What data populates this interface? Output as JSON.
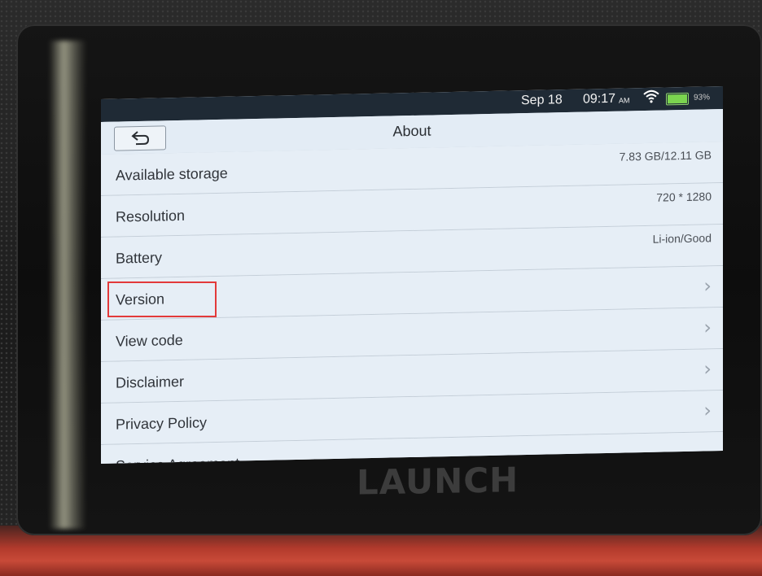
{
  "status_bar": {
    "date": "Sep 18",
    "time": "09:17",
    "ampm": "AM",
    "battery_percent": "93%",
    "wifi_icon": "wifi-icon",
    "battery_icon": "battery-icon"
  },
  "header": {
    "title": "About",
    "back_icon": "back-arrow-icon"
  },
  "rows": [
    {
      "label": "Available storage",
      "value": "7.83 GB/12.11 GB"
    },
    {
      "label": "Resolution",
      "value": "720 * 1280"
    },
    {
      "label": "Battery",
      "value": "Li-ion/Good"
    },
    {
      "label": "Version",
      "chevron": "chevron-right-icon"
    },
    {
      "label": "View code",
      "chevron": "chevron-right-icon"
    },
    {
      "label": "Disclaimer",
      "chevron": "chevron-right-icon"
    },
    {
      "label": "Privacy Policy",
      "chevron": "chevron-right-icon"
    },
    {
      "label": "Service Agreement"
    }
  ],
  "brand": "LAUNCH",
  "colors": {
    "highlight": "#e23a3a",
    "accent_device": "#c84a38"
  }
}
